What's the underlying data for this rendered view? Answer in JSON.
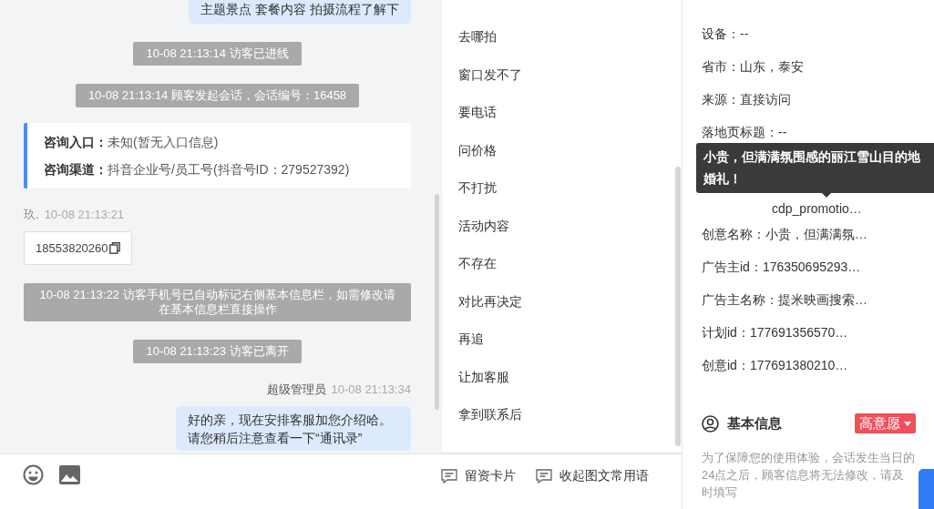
{
  "chat": {
    "messages": [
      {
        "kind": "bubble",
        "text": "主题景点 套餐内容 拍摄流程了解下"
      },
      {
        "kind": "notice",
        "text": "10-08 21:13:14 访客已进线"
      },
      {
        "kind": "notice",
        "text": "10-08 21:13:14 顾客发起会话，会话编号：16458"
      },
      {
        "kind": "entry_card",
        "fields": [
          {
            "label": "咨询入口：",
            "value": "未知(暂无入口信息)"
          },
          {
            "label": "咨询渠道：",
            "value": "抖音企业号/员工号(抖音号ID：279527392)"
          }
        ]
      },
      {
        "kind": "sender",
        "outgoing": false,
        "name": "玖.",
        "time": "10-08 21:13:21"
      },
      {
        "kind": "phone",
        "text": "18553820260"
      },
      {
        "kind": "notice",
        "text": "10-08 21:13:22 访客手机号已自动标记右侧基本信息栏，如需修改请在基本信息栏直接操作"
      },
      {
        "kind": "notice",
        "text": "10-08 21:13:23 访客已离开"
      },
      {
        "kind": "sender",
        "outgoing": true,
        "name": "超级管理员",
        "time": "10-08 21:13:34"
      },
      {
        "kind": "bubble",
        "text": "好的亲，现在安排客服加您介绍哈。请您稍后注意查看一下“通讯录”"
      }
    ]
  },
  "phrases": [
    "去哪拍",
    "窗口发不了",
    "要电话",
    "问价格",
    "不打扰",
    "活动内容",
    "不存在",
    "对比再决定",
    "再追",
    "让加客服",
    "拿到联系后"
  ],
  "input_bar": {
    "actions": [
      "留资卡片",
      "收起图文常用语"
    ]
  },
  "source_info": {
    "rows": [
      {
        "kind": "row",
        "text": "设备：--"
      },
      {
        "kind": "row",
        "text": "省市：山东，泰安"
      },
      {
        "kind": "row",
        "text": "来源：直接访问"
      },
      {
        "kind": "row",
        "text": "落地页标题：--"
      },
      {
        "kind": "tooltip",
        "text": "小贵，但满满氛围感的丽江雪山目的地婚礼！"
      },
      {
        "kind": "covered_row",
        "text": "cdp_promotio…"
      },
      {
        "kind": "row",
        "text": "创意名称：小贵，但满满氛…"
      },
      {
        "kind": "row",
        "text": "广告主id：176350695293…"
      },
      {
        "kind": "row",
        "text": "广告主名称：提米映画搜索…"
      },
      {
        "kind": "row",
        "text": "计划id：177691356570…"
      },
      {
        "kind": "row",
        "text": "创意id：177691380210…"
      }
    ]
  },
  "basic_info": {
    "title": "基本信息",
    "intent_badge": "高意愿",
    "note": "为了保障您的使用体验，会话发生当日的24点之后，顾客信息将无法修改，请及时填写"
  }
}
